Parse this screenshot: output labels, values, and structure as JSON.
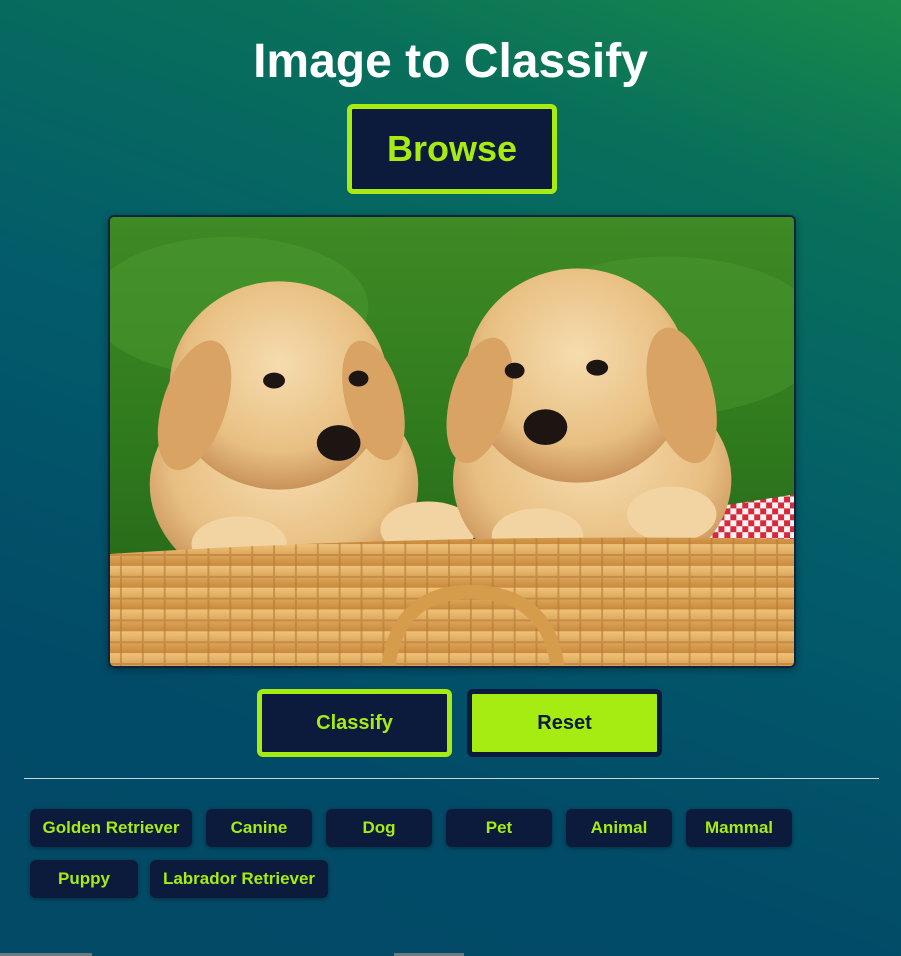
{
  "page": {
    "title": "Image to Classify"
  },
  "controls": {
    "browse_label": "Browse",
    "classify_label": "Classify",
    "reset_label": "Reset"
  },
  "tags": [
    "Golden Retriever",
    "Canine",
    "Dog",
    "Pet",
    "Animal",
    "Mammal",
    "Puppy",
    "Labrador Retriever"
  ],
  "colors": {
    "accent": "#a6eb12",
    "button_dark": "#0c1a3c",
    "title_text": "#ffffff"
  }
}
